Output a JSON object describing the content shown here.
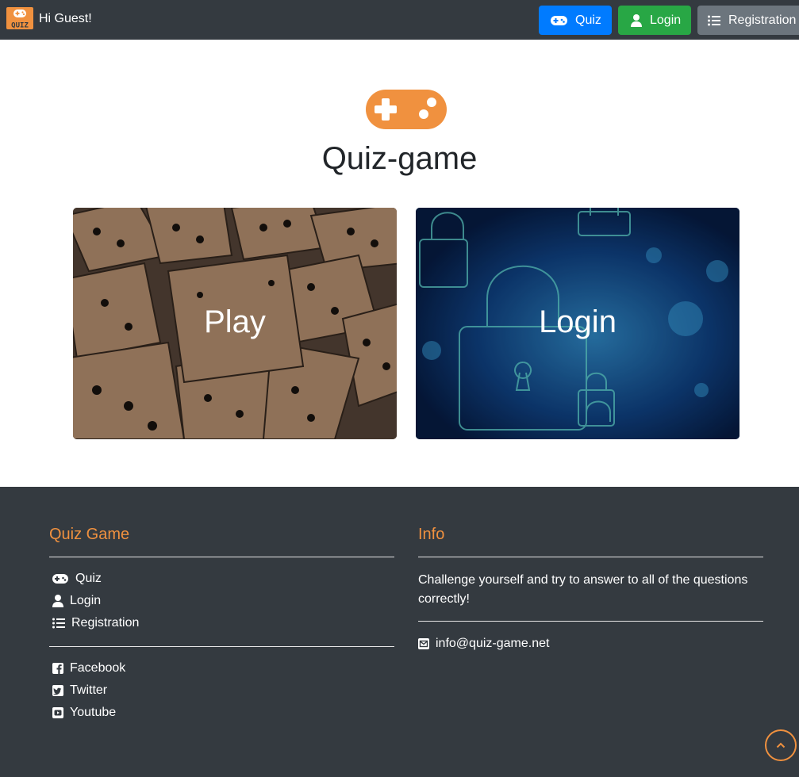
{
  "header": {
    "logo_text": "QUIZ",
    "greeting": "Hi Guest!",
    "buttons": [
      {
        "label": "Quiz",
        "icon": "gamepad-icon",
        "color": "#007bff"
      },
      {
        "label": "Login",
        "icon": "user-icon",
        "color": "#28a745"
      },
      {
        "label": "Registration",
        "icon": "list-icon",
        "color": "#6c757d"
      }
    ]
  },
  "hero": {
    "icon": "gamepad-icon",
    "title": "Quiz-game",
    "accent": "#f0913f"
  },
  "cards": [
    {
      "label": "Play",
      "image": "dominoes"
    },
    {
      "label": "Login",
      "image": "digital-padlock"
    }
  ],
  "footer": {
    "left": {
      "heading": "Quiz Game",
      "links": [
        {
          "label": "Quiz",
          "icon": "gamepad-icon"
        },
        {
          "label": "Login",
          "icon": "user-icon"
        },
        {
          "label": "Registration",
          "icon": "list-icon"
        }
      ],
      "social": [
        {
          "label": "Facebook",
          "icon": "facebook-icon"
        },
        {
          "label": "Twitter",
          "icon": "twitter-icon"
        },
        {
          "label": "Youtube",
          "icon": "youtube-icon"
        }
      ]
    },
    "right": {
      "heading": "Info",
      "text": "Challenge yourself and try to answer to all of the questions correctly!",
      "email": "info@quiz-game.net",
      "email_icon": "envelope-icon"
    },
    "back_to_top_icon": "chevron-up-icon"
  }
}
